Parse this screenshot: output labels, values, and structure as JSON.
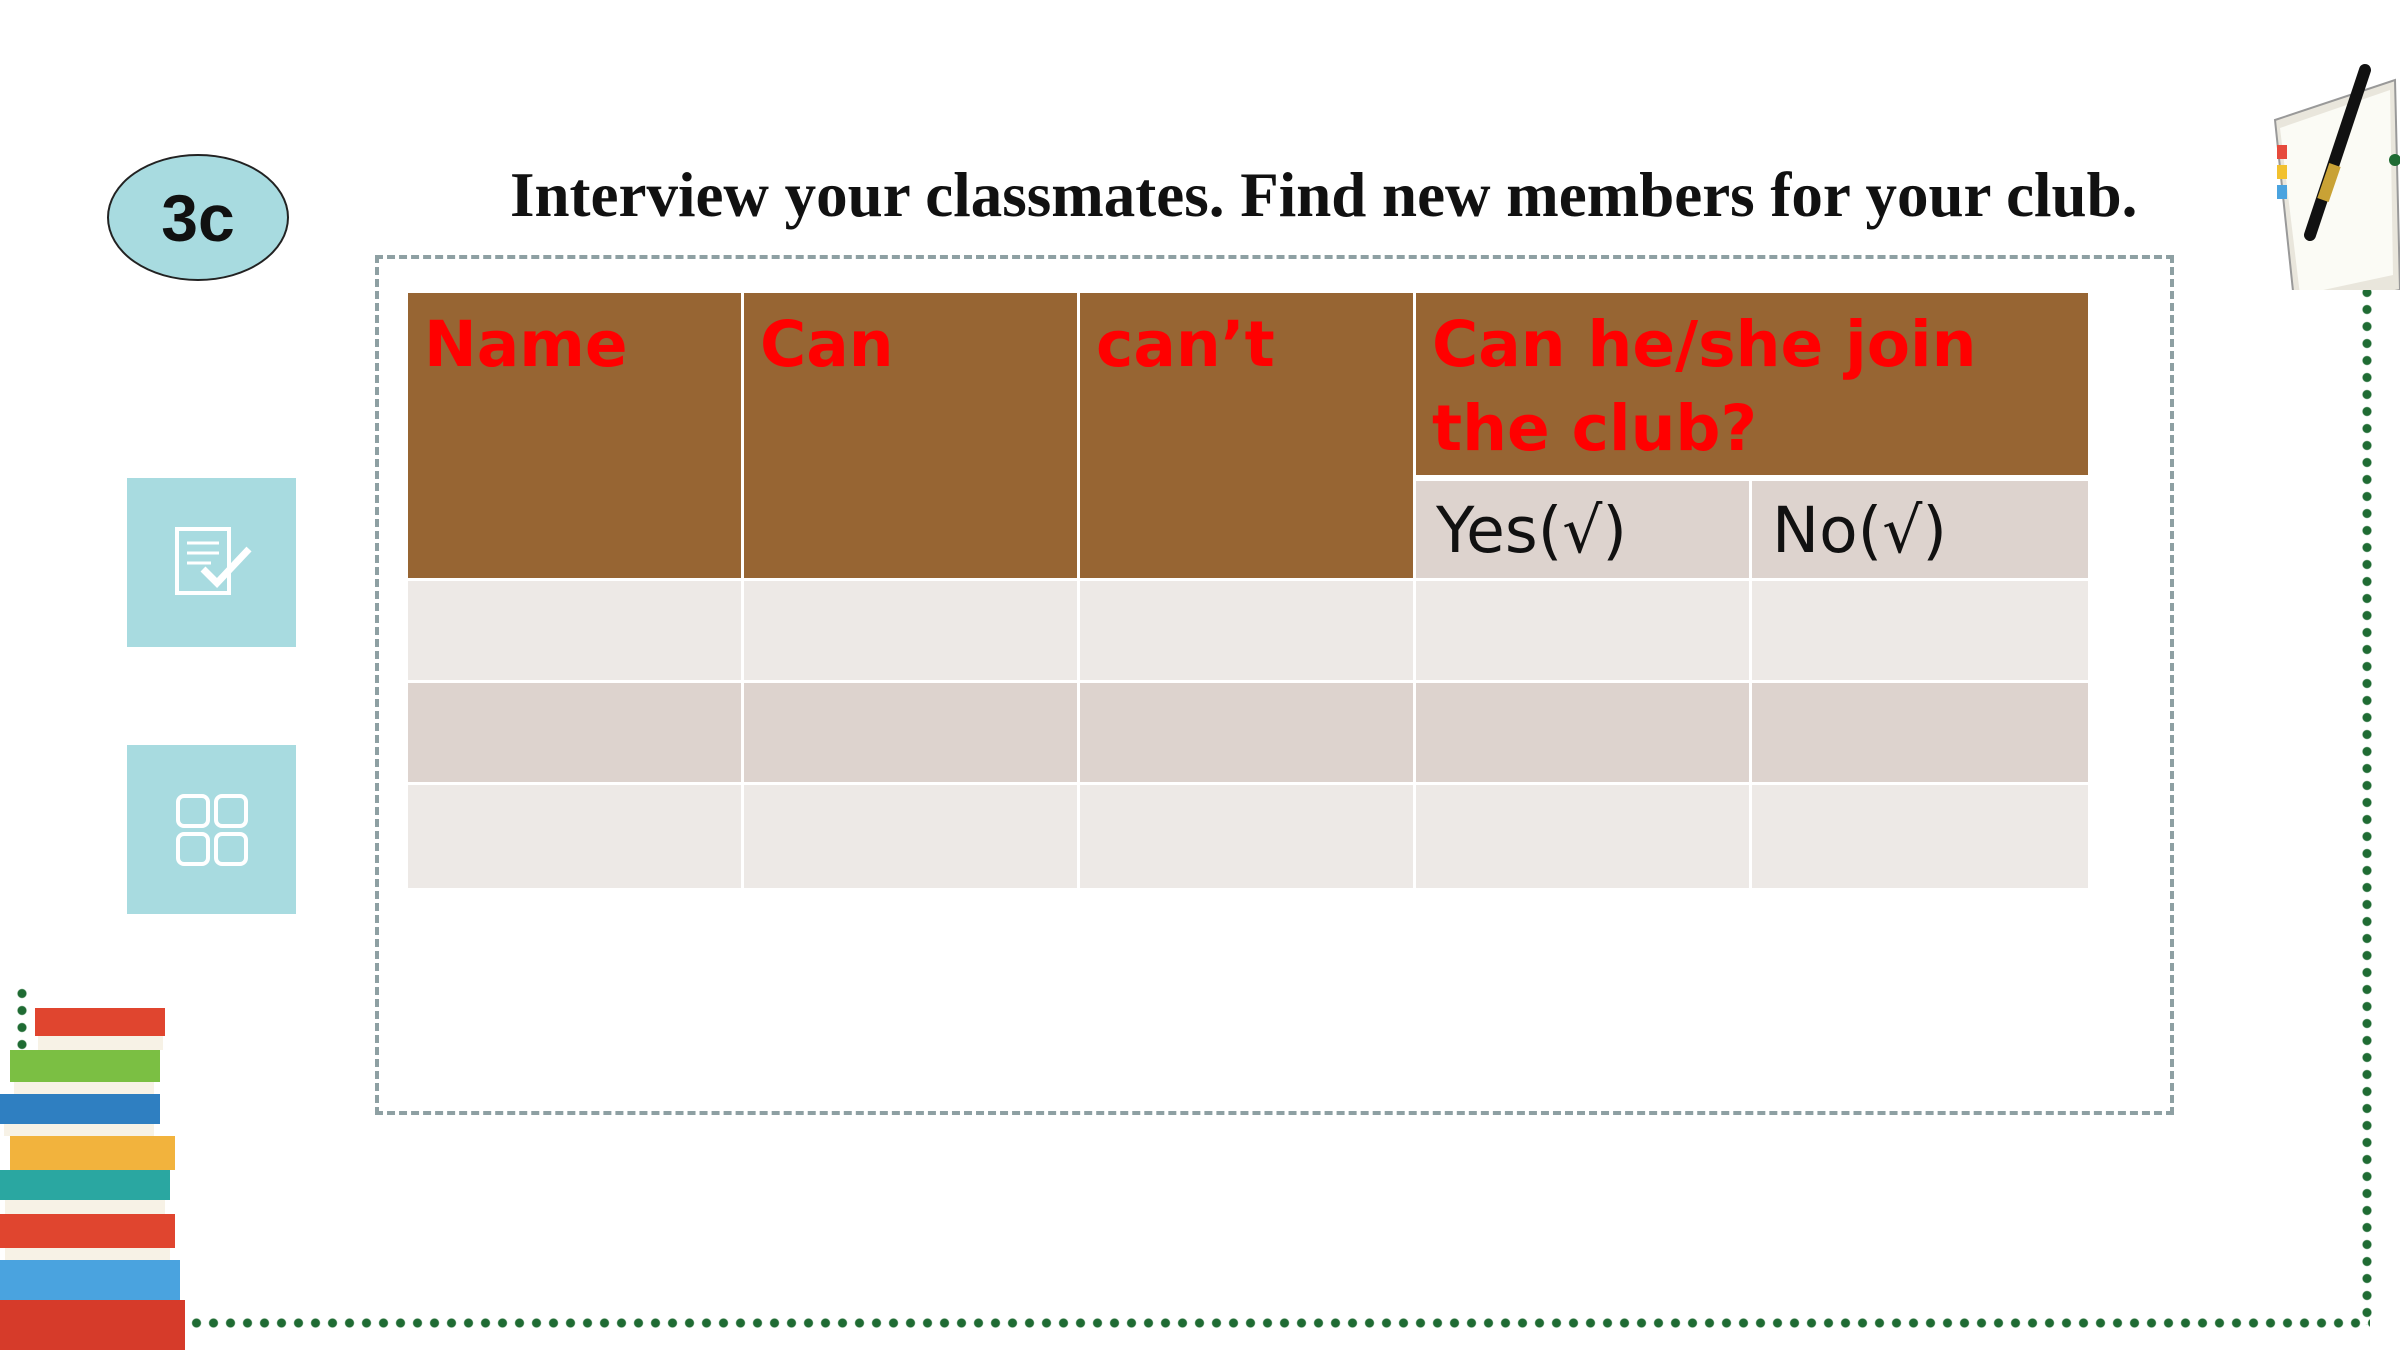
{
  "badge": {
    "label": "3c"
  },
  "title": "Interview your classmates. Find new members for your club.",
  "table": {
    "headers": [
      "Name",
      "Can",
      "can’t",
      "Can he/she join the club?"
    ],
    "subheaders": [
      "Yes(√)",
      "No(√)"
    ],
    "rows": [
      [
        "",
        "",
        "",
        "",
        ""
      ],
      [
        "",
        "",
        "",
        "",
        ""
      ],
      [
        "",
        "",
        "",
        "",
        ""
      ]
    ]
  },
  "side_buttons": [
    {
      "icon": "checklist-icon"
    },
    {
      "icon": "grid-icon"
    }
  ],
  "colors": {
    "header_bg": "#976533",
    "header_text": "#ff0000",
    "badge_bg": "#a8dbe0",
    "side_button_bg": "#a8dbe0",
    "row_light": "#ede9e6",
    "row_dark": "#ddd3ce",
    "dotted_border": "#1f6b33"
  }
}
